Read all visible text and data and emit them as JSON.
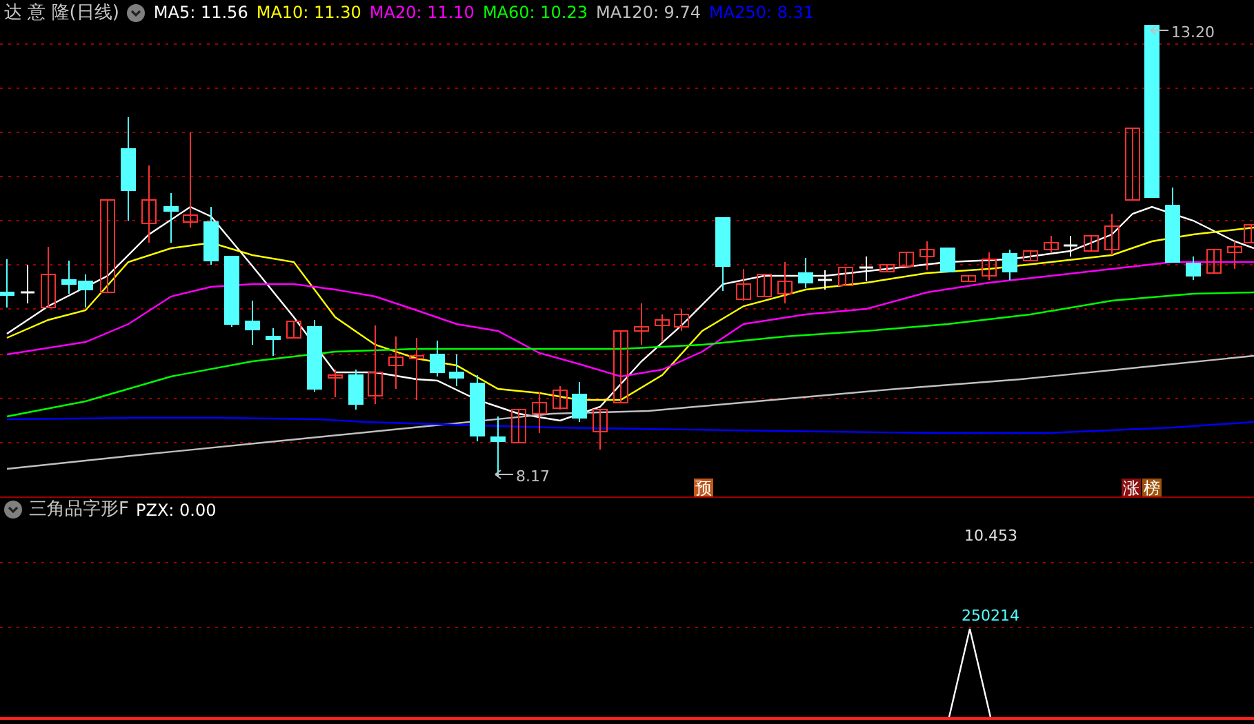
{
  "header": {
    "title": "达 意 隆(日线)",
    "indicators": [
      {
        "label": "MA5: 11.56",
        "color": "#ffffff"
      },
      {
        "label": "MA10: 11.30",
        "color": "#ffff00"
      },
      {
        "label": "MA20: 11.10",
        "color": "#ff00ff"
      },
      {
        "label": "MA60: 10.23",
        "color": "#00ff00"
      },
      {
        "label": "MA120: 9.74",
        "color": "#c0c0c0"
      },
      {
        "label": "MA250: 8.31",
        "color": "#0000ff"
      }
    ]
  },
  "price_labels": [
    {
      "text": "13.20"
    },
    {
      "text": "8.17"
    }
  ],
  "badges": [
    {
      "text": "预",
      "color": "#c0581a"
    },
    {
      "text": "涨",
      "color": "#8b1010"
    },
    {
      "text": "榜",
      "color": "#a0520a"
    }
  ],
  "lower_panel": {
    "title": "三角品字形F",
    "indicators": [
      {
        "label": "PZX: 0.00",
        "color": "#ffffff"
      }
    ],
    "axis_value": "10.453",
    "peak_label": "250214"
  }
}
